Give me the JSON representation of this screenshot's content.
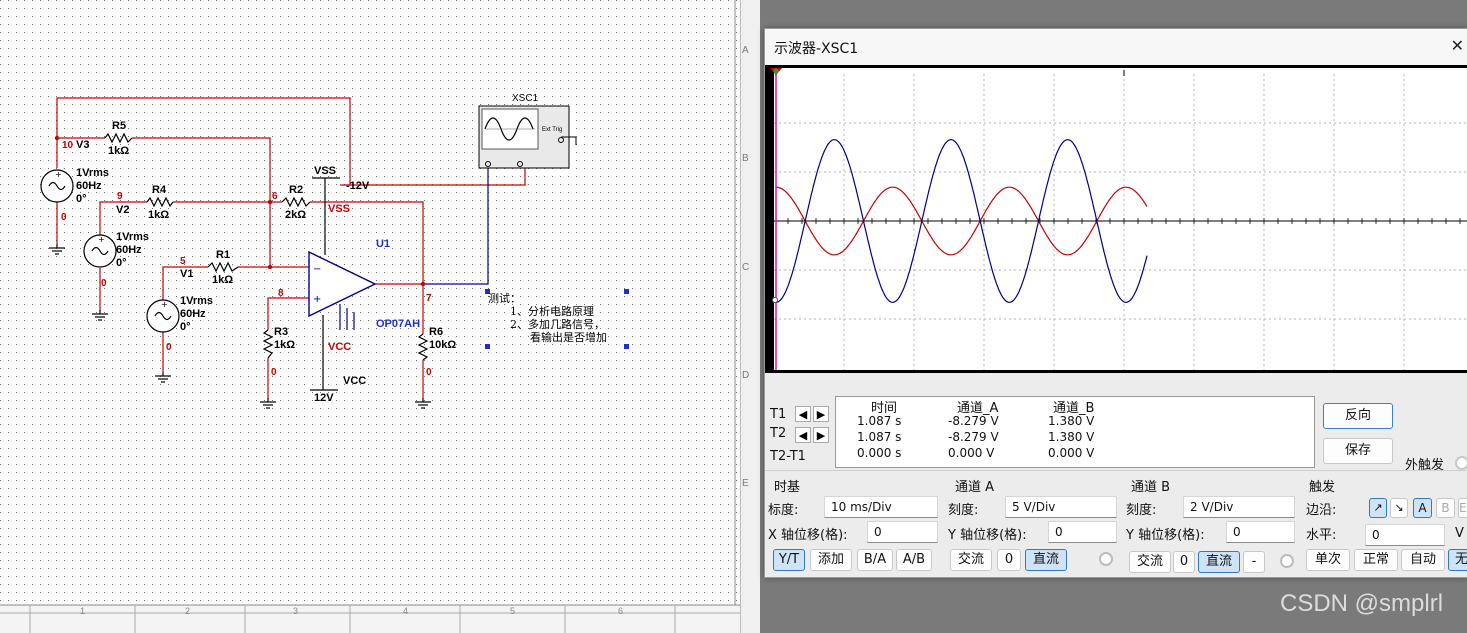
{
  "schematic": {
    "instrument_label": "XSC1",
    "ext_trig": "Ext Trig",
    "note_lines": [
      "测试：",
      "1、分析电路原理",
      "2、多加几路信号，",
      "看输出是否增加"
    ],
    "row_labels": [
      "A",
      "B",
      "C",
      "D",
      "E"
    ],
    "col_labels": [
      "1",
      "2",
      "3",
      "4",
      "5",
      "6"
    ],
    "components": {
      "v3": {
        "name": "V3",
        "l1": "1Vrms",
        "l2": "60Hz",
        "l3": "0°"
      },
      "v2": {
        "name": "V2",
        "l1": "1Vrms",
        "l2": "60Hz",
        "l3": "0°"
      },
      "v1": {
        "name": "V1",
        "l1": "1Vrms",
        "l2": "60Hz",
        "l3": "0°"
      },
      "r5": {
        "name": "R5",
        "val": "1kΩ"
      },
      "r4": {
        "name": "R4",
        "val": "1kΩ"
      },
      "r1": {
        "name": "R1",
        "val": "1kΩ"
      },
      "r2": {
        "name": "R2",
        "val": "2kΩ"
      },
      "r3": {
        "name": "R3",
        "val": "1kΩ"
      },
      "r6": {
        "name": "R6",
        "val": "10kΩ"
      },
      "u1": {
        "name": "U1",
        "part": "OP07AH"
      },
      "vss_top": "VSS",
      "vss_net": "VSS",
      "neg12": "-12V",
      "vcc_net": "VCC",
      "vcc_bot": "VCC",
      "pos12": "12V"
    },
    "nodes": [
      "10",
      "9",
      "5",
      "6",
      "8",
      "7",
      "0",
      "0",
      "0",
      "0",
      "0"
    ]
  },
  "scope": {
    "title": "示波器-XSC1",
    "close": "✕",
    "colors": {
      "channel_a": "#00008b",
      "channel_b": "#cc0000",
      "trigger": "#cc00cc",
      "grid": "#9a9a9a",
      "axis": "#000000"
    },
    "readout": {
      "headers": [
        "时间",
        "通道_A",
        "通道_B"
      ],
      "rows": [
        {
          "label": "T1",
          "time": "1.087 s",
          "a": "-8.279 V",
          "b": "1.380 V"
        },
        {
          "label": "T2",
          "time": "1.087 s",
          "a": "-8.279 V",
          "b": "1.380 V"
        },
        {
          "label": "T2-T1",
          "time": "0.000 s",
          "a": "0.000 V",
          "b": "0.000 V"
        }
      ]
    },
    "buttons": {
      "reverse": "反向",
      "save": "保存"
    },
    "ext_trigger": "外触发",
    "timebase": {
      "title": "时基",
      "scale_label": "标度:",
      "scale": "10 ms/Div",
      "xoffset_label": "X 轴位移(格):",
      "xoffset": "0",
      "modes": [
        "Y/T",
        "添加",
        "B/A",
        "A/B"
      ]
    },
    "channel_a": {
      "title": "通道 A",
      "scale_label": "刻度:",
      "scale": "5  V/Div",
      "yoffset_label": "Y 轴位移(格):",
      "yoffset": "0",
      "coupling": [
        "交流",
        "0",
        "直流"
      ]
    },
    "channel_b": {
      "title": "通道 B",
      "scale_label": "刻度:",
      "scale": "2  V/Div",
      "yoffset_label": "Y 轴位移(格):",
      "yoffset": "0",
      "coupling": [
        "交流",
        "0",
        "直流",
        "-"
      ]
    },
    "trigger": {
      "title": "触发",
      "edge_label": "边沿:",
      "level_label": "水平:",
      "level": "0",
      "level_unit": "V",
      "sources": [
        "A",
        "B",
        "Ext"
      ],
      "modes": [
        "单次",
        "正常",
        "自动",
        "无"
      ]
    }
  },
  "watermark": "CSDN @smplrl",
  "chart_data": {
    "type": "line",
    "title": "",
    "x_unit": "ms",
    "x_per_div": 10,
    "divisions_x": 10,
    "divisions_y": 6,
    "series": [
      {
        "name": "通道_A",
        "volts_per_div": 5,
        "frequency_hz": 60,
        "amplitude_v": 8.3,
        "phase_deg": -90,
        "t_end_ms": 53,
        "sample_values_v": [
          -8.28,
          0,
          8.3,
          0,
          -8.3,
          0,
          8.3,
          0,
          -8.3,
          0,
          8.3,
          0
        ]
      },
      {
        "name": "通道_B",
        "volts_per_div": 2,
        "frequency_hz": 60,
        "amplitude_v": 1.38,
        "phase_deg": 90,
        "t_end_ms": 53,
        "sample_values_v": [
          1.38,
          0,
          -1.38,
          0,
          1.38,
          0,
          -1.38,
          0,
          1.38,
          0,
          -1.38,
          0
        ]
      }
    ]
  }
}
